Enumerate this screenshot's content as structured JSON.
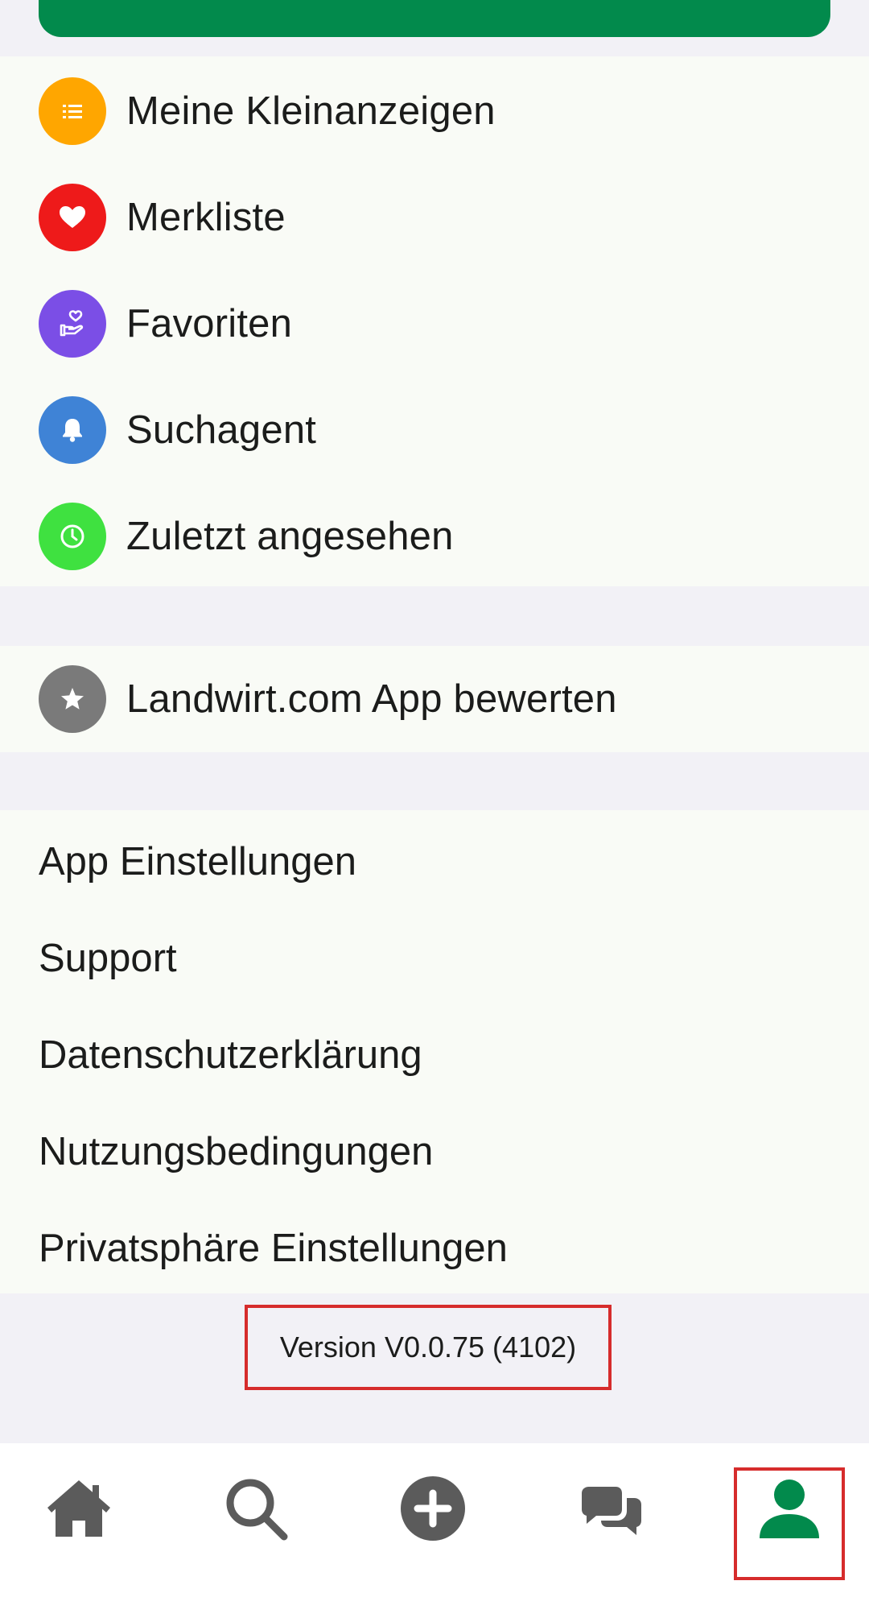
{
  "menu": {
    "items": [
      {
        "label": "Meine Kleinanzeigen",
        "icon": "list-icon",
        "color": "#ffa600"
      },
      {
        "label": "Merkliste",
        "icon": "heart-icon",
        "color": "#ee1a1a"
      },
      {
        "label": "Favoriten",
        "icon": "hand-heart-icon",
        "color": "#7b4ee6"
      },
      {
        "label": "Suchagent",
        "icon": "bell-icon",
        "color": "#3f83d6"
      },
      {
        "label": "Zuletzt angesehen",
        "icon": "clock-icon",
        "color": "#3fe140"
      }
    ],
    "rate": {
      "label": "Landwirt.com App bewerten",
      "icon": "star-icon",
      "color": "#7a7a7a"
    }
  },
  "links": [
    "App Einstellungen",
    "Support",
    "Datenschutzerklärung",
    "Nutzungsbedingungen",
    "Privatsphäre Einstellungen"
  ],
  "version": "Version V0.0.75 (4102)",
  "bottom_nav": {
    "items": [
      "home-icon",
      "search-icon",
      "add-icon",
      "chat-icon",
      "profile-icon"
    ],
    "active": "profile-icon",
    "active_color": "#028a4c",
    "inactive_color": "#5b5b5b"
  },
  "colors": {
    "brand_green": "#028a4c",
    "highlight_red": "#d62c2c"
  }
}
